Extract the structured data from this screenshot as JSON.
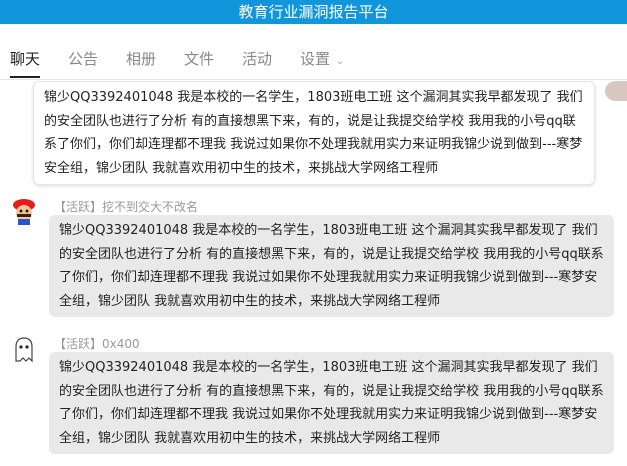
{
  "app": {
    "title": "教育行业漏洞报告平台"
  },
  "tabs": [
    {
      "label": "聊天"
    },
    {
      "label": "公告"
    },
    {
      "label": "相册"
    },
    {
      "label": "文件"
    },
    {
      "label": "活动"
    },
    {
      "label": "设置"
    }
  ],
  "messages": [
    {
      "tag": "",
      "sender": "",
      "text": "锦少QQ3392401048 我是本校的一名学生，1803班电工班 这个漏洞其实我早都发现了 我们的安全团队也进行了分析 有的直接想黑下来，有的，说是让我提交给学校 我用我的小号qq联系了你们，你们却连理都不理我 我说过如果你不处理我就用实力来证明我锦少说到做到---寒梦安全组，锦少团队 我就喜欢用初中生的技术，来挑战大学网络工程师"
    },
    {
      "tag": "【活跃】",
      "sender": "挖不到交大不改名",
      "avatar_icon": "mario-avatar-icon",
      "text": "锦少QQ3392401048 我是本校的一名学生，1803班电工班 这个漏洞其实我早都发现了 我们的安全团队也进行了分析 有的直接想黑下来，有的，说是让我提交给学校 我用我的小号qq联系了你们，你们却连理都不理我 我说过如果你不处理我就用实力来证明我锦少说到做到---寒梦安全组，锦少团队 我就喜欢用初中生的技术，来挑战大学网络工程师"
    },
    {
      "tag": "【活跃】",
      "sender": "0x400",
      "avatar_icon": "ghost-avatar-icon",
      "text": "锦少QQ3392401048 我是本校的一名学生，1803班电工班 这个漏洞其实我早都发现了 我们的安全团队也进行了分析 有的直接想黑下来，有的，说是让我提交给学校 我用我的小号qq联系了你们，你们却连理都不理我 我说过如果你不处理我就用实力来证明我锦少说到做到---寒梦安全组，锦少团队 我就喜欢用初中生的技术，来挑战大学网络工程师"
    }
  ],
  "colors": {
    "header": "#1296db",
    "bubble_other": "#e9e9e9",
    "meta_text": "#999999"
  }
}
